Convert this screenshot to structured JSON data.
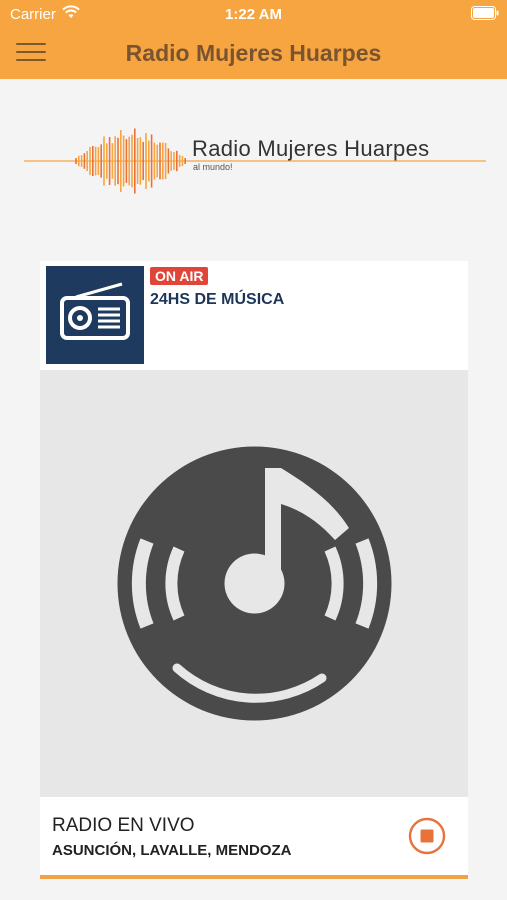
{
  "status_bar": {
    "carrier": "Carrier",
    "time": "1:22 AM"
  },
  "header": {
    "title": "Radio Mujeres Huarpes",
    "menu_icon": "hamburger-menu-icon"
  },
  "logo": {
    "name": "Radio Mujeres Huarpes",
    "tagline": "al mundo!"
  },
  "card": {
    "badge": "ON AIR",
    "program": "24HS DE MÚSICA",
    "thumbnail_icon": "radio-icon",
    "artwork_icon": "music-disc-icon",
    "station_title": "RADIO EN VIVO",
    "location": "ASUNCIÓN, LAVALLE, MENDOZA",
    "stop_icon": "stop-icon",
    "progress": 1.0
  },
  "colors": {
    "accent": "#f7a540",
    "badge": "#e0453a",
    "stop": "#e8733a",
    "program_text": "#1d3557",
    "header_text": "#7a5430"
  }
}
